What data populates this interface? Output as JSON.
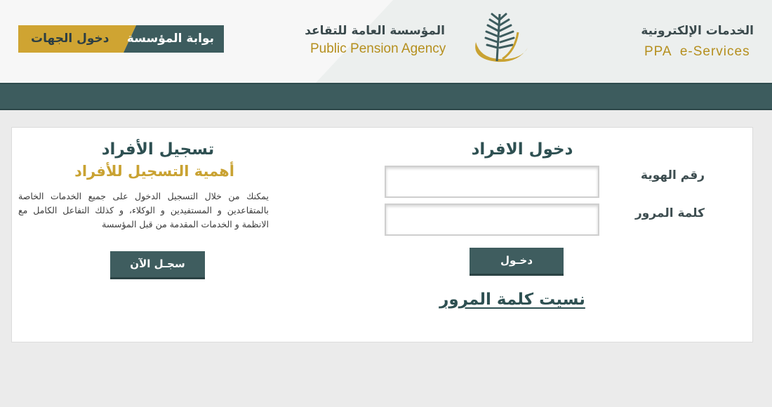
{
  "header": {
    "portal_switch": {
      "institution_label": "بوابة المؤسسة",
      "entities_label": "دخول الجهات"
    },
    "agency": {
      "name_ar": "المؤسسة العامة للتقاعد",
      "name_en": "Public Pension Agency"
    },
    "eservices": {
      "title_ar": "الخدمات الإلكترونية",
      "title_en": "PPA  e-Services"
    }
  },
  "login": {
    "title": "دخول الافراد",
    "id_label": "رقم الهوية",
    "password_label": "كلمة المرور",
    "id_value": "",
    "password_value": "",
    "submit_label": "دخـول",
    "forgot_label": "نسيت كلمة المرور"
  },
  "registration": {
    "title": "تسجيل الأفراد",
    "subtitle": "أهمية التسجيل للأفراد",
    "description": "يمكنك من خلال التسجيل الدخول على جميع الخدمات الخاصة بالمتقاعدين و المستفيدين و الوكلاء، و كذلك التفاعل الكامل مع الانظمة و الخدمات المقدمة من قبل المؤسسة",
    "register_label": "سجـل الآن"
  },
  "colors": {
    "primary_teal": "#3d5c5e",
    "accent_gold": "#c9a232",
    "title_teal": "#2e5052",
    "background": "#ebebeb"
  },
  "icons": {
    "logo": "palm-frond-logo"
  }
}
